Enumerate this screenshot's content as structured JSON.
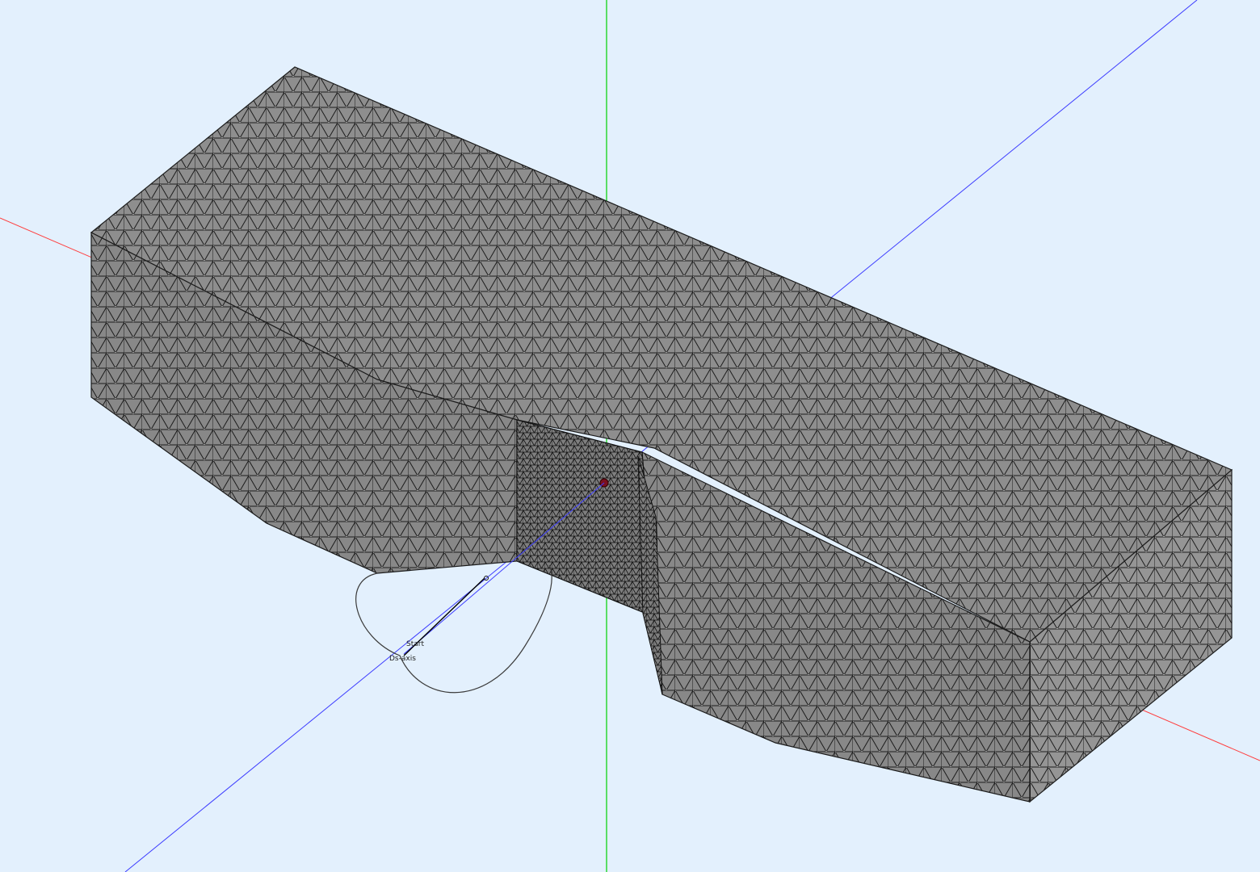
{
  "viewport": {
    "background": "#e3f0fd",
    "labels": {
      "start": "Start",
      "axis": "Ds-axis"
    }
  },
  "axes": {
    "x_color": "#ff3c3c",
    "y_color": "#00d000",
    "z_color": "#3c3cff"
  },
  "mesh": {
    "face_color": "#8e8e8e",
    "edge_color": "#1c1c1c",
    "node_color": "#f2f2f2"
  },
  "curve": {
    "color": "#3a3a3a"
  }
}
